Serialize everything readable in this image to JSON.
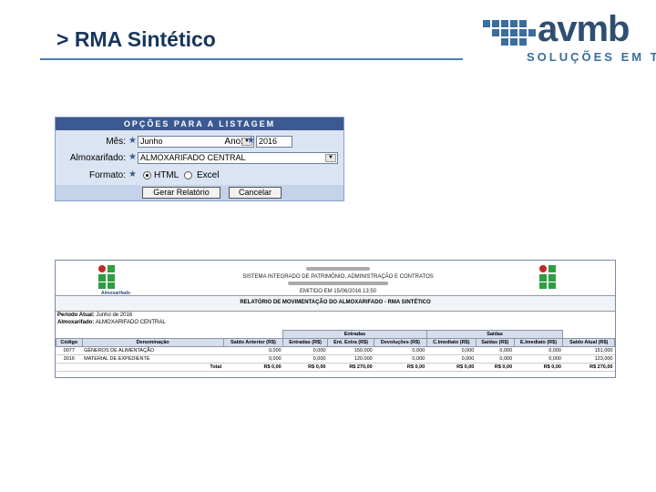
{
  "slide": {
    "title": "> RMA Sintético"
  },
  "logo": {
    "word": "avmb",
    "subtitle": "SOLUÇÕES EM TI",
    "colors": {
      "dark": "#2f4f72",
      "light": "#3a6e9e"
    }
  },
  "form": {
    "header": "OPÇÕES PARA A LISTAGEM",
    "mes_label": "Mês:",
    "mes_value": "Junho",
    "ano_label": "Ano:",
    "ano_value": "2016",
    "almox_label": "Almoxarifado:",
    "almox_value": "ALMOXARIFADO CENTRAL",
    "formato_label": "Formato:",
    "formato_options": [
      "HTML",
      "Excel"
    ],
    "formato_selected": "HTML",
    "gerar_button": "Gerar Relatório",
    "cancelar_button": "Cancelar"
  },
  "report": {
    "header_lines": [
      "SISTEMA INTEGRADO DE PATRIMÔNIO, ADMINISTRAÇÃO E CONTRATOS",
      "EMITIDO EM 15/06/2016 13:50"
    ],
    "logo_caption": "Almoxarifado",
    "title": "RELATÓRIO DE MOVIMENTAÇÃO DO ALMOXARIFADO - RMA SINTÉTICO",
    "periodo_label": "Período Atual:",
    "periodo_value": "Junho de 2016",
    "almox_label": "Almoxarifado:",
    "almox_value": "ALMOXARIFADO CENTRAL",
    "group_entradas": "Entradas",
    "group_saidas": "Saídas",
    "columns": [
      "Código",
      "Denominação",
      "Saldo Anterior (R$)",
      "Entradas (R$)",
      "Ent. Extra (R$)",
      "Devoluções (R$)",
      "C.Imediato (R$)",
      "Saídas (R$)",
      "E.Imediato (R$)",
      "Saldo Atual (R$)"
    ],
    "rows": [
      [
        "0077",
        "GÊNEROS DE ALIMENTAÇÃO",
        "0,000",
        "0,000",
        "150.000",
        "0,000",
        "0,000",
        "0,000",
        "0,000",
        "151,000"
      ],
      [
        "3016",
        "MATERIAL DE EXPEDIENTE",
        "0,000",
        "0,000",
        "120.000",
        "0,000",
        "0,000",
        "0,000",
        "0,000",
        "123,000"
      ]
    ],
    "total": [
      "Total",
      "R$ 0,00",
      "R$ 0,00",
      "R$ 270,00",
      "R$ 0,00",
      "R$ 0,00",
      "R$ 0,00",
      "R$ 0,00",
      "R$ 270,00"
    ]
  }
}
